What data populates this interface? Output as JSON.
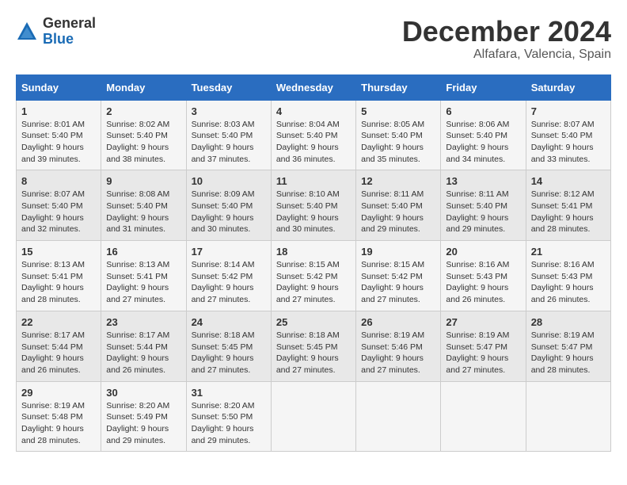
{
  "header": {
    "logo_general": "General",
    "logo_blue": "Blue",
    "month": "December 2024",
    "location": "Alfafara, Valencia, Spain"
  },
  "days_of_week": [
    "Sunday",
    "Monday",
    "Tuesday",
    "Wednesday",
    "Thursday",
    "Friday",
    "Saturday"
  ],
  "weeks": [
    [
      {
        "day": "1",
        "sunrise": "Sunrise: 8:01 AM",
        "sunset": "Sunset: 5:40 PM",
        "daylight": "Daylight: 9 hours and 39 minutes."
      },
      {
        "day": "2",
        "sunrise": "Sunrise: 8:02 AM",
        "sunset": "Sunset: 5:40 PM",
        "daylight": "Daylight: 9 hours and 38 minutes."
      },
      {
        "day": "3",
        "sunrise": "Sunrise: 8:03 AM",
        "sunset": "Sunset: 5:40 PM",
        "daylight": "Daylight: 9 hours and 37 minutes."
      },
      {
        "day": "4",
        "sunrise": "Sunrise: 8:04 AM",
        "sunset": "Sunset: 5:40 PM",
        "daylight": "Daylight: 9 hours and 36 minutes."
      },
      {
        "day": "5",
        "sunrise": "Sunrise: 8:05 AM",
        "sunset": "Sunset: 5:40 PM",
        "daylight": "Daylight: 9 hours and 35 minutes."
      },
      {
        "day": "6",
        "sunrise": "Sunrise: 8:06 AM",
        "sunset": "Sunset: 5:40 PM",
        "daylight": "Daylight: 9 hours and 34 minutes."
      },
      {
        "day": "7",
        "sunrise": "Sunrise: 8:07 AM",
        "sunset": "Sunset: 5:40 PM",
        "daylight": "Daylight: 9 hours and 33 minutes."
      }
    ],
    [
      {
        "day": "8",
        "sunrise": "Sunrise: 8:07 AM",
        "sunset": "Sunset: 5:40 PM",
        "daylight": "Daylight: 9 hours and 32 minutes."
      },
      {
        "day": "9",
        "sunrise": "Sunrise: 8:08 AM",
        "sunset": "Sunset: 5:40 PM",
        "daylight": "Daylight: 9 hours and 31 minutes."
      },
      {
        "day": "10",
        "sunrise": "Sunrise: 8:09 AM",
        "sunset": "Sunset: 5:40 PM",
        "daylight": "Daylight: 9 hours and 30 minutes."
      },
      {
        "day": "11",
        "sunrise": "Sunrise: 8:10 AM",
        "sunset": "Sunset: 5:40 PM",
        "daylight": "Daylight: 9 hours and 30 minutes."
      },
      {
        "day": "12",
        "sunrise": "Sunrise: 8:11 AM",
        "sunset": "Sunset: 5:40 PM",
        "daylight": "Daylight: 9 hours and 29 minutes."
      },
      {
        "day": "13",
        "sunrise": "Sunrise: 8:11 AM",
        "sunset": "Sunset: 5:40 PM",
        "daylight": "Daylight: 9 hours and 29 minutes."
      },
      {
        "day": "14",
        "sunrise": "Sunrise: 8:12 AM",
        "sunset": "Sunset: 5:41 PM",
        "daylight": "Daylight: 9 hours and 28 minutes."
      }
    ],
    [
      {
        "day": "15",
        "sunrise": "Sunrise: 8:13 AM",
        "sunset": "Sunset: 5:41 PM",
        "daylight": "Daylight: 9 hours and 28 minutes."
      },
      {
        "day": "16",
        "sunrise": "Sunrise: 8:13 AM",
        "sunset": "Sunset: 5:41 PM",
        "daylight": "Daylight: 9 hours and 27 minutes."
      },
      {
        "day": "17",
        "sunrise": "Sunrise: 8:14 AM",
        "sunset": "Sunset: 5:42 PM",
        "daylight": "Daylight: 9 hours and 27 minutes."
      },
      {
        "day": "18",
        "sunrise": "Sunrise: 8:15 AM",
        "sunset": "Sunset: 5:42 PM",
        "daylight": "Daylight: 9 hours and 27 minutes."
      },
      {
        "day": "19",
        "sunrise": "Sunrise: 8:15 AM",
        "sunset": "Sunset: 5:42 PM",
        "daylight": "Daylight: 9 hours and 27 minutes."
      },
      {
        "day": "20",
        "sunrise": "Sunrise: 8:16 AM",
        "sunset": "Sunset: 5:43 PM",
        "daylight": "Daylight: 9 hours and 26 minutes."
      },
      {
        "day": "21",
        "sunrise": "Sunrise: 8:16 AM",
        "sunset": "Sunset: 5:43 PM",
        "daylight": "Daylight: 9 hours and 26 minutes."
      }
    ],
    [
      {
        "day": "22",
        "sunrise": "Sunrise: 8:17 AM",
        "sunset": "Sunset: 5:44 PM",
        "daylight": "Daylight: 9 hours and 26 minutes."
      },
      {
        "day": "23",
        "sunrise": "Sunrise: 8:17 AM",
        "sunset": "Sunset: 5:44 PM",
        "daylight": "Daylight: 9 hours and 26 minutes."
      },
      {
        "day": "24",
        "sunrise": "Sunrise: 8:18 AM",
        "sunset": "Sunset: 5:45 PM",
        "daylight": "Daylight: 9 hours and 27 minutes."
      },
      {
        "day": "25",
        "sunrise": "Sunrise: 8:18 AM",
        "sunset": "Sunset: 5:45 PM",
        "daylight": "Daylight: 9 hours and 27 minutes."
      },
      {
        "day": "26",
        "sunrise": "Sunrise: 8:19 AM",
        "sunset": "Sunset: 5:46 PM",
        "daylight": "Daylight: 9 hours and 27 minutes."
      },
      {
        "day": "27",
        "sunrise": "Sunrise: 8:19 AM",
        "sunset": "Sunset: 5:47 PM",
        "daylight": "Daylight: 9 hours and 27 minutes."
      },
      {
        "day": "28",
        "sunrise": "Sunrise: 8:19 AM",
        "sunset": "Sunset: 5:47 PM",
        "daylight": "Daylight: 9 hours and 28 minutes."
      }
    ],
    [
      {
        "day": "29",
        "sunrise": "Sunrise: 8:19 AM",
        "sunset": "Sunset: 5:48 PM",
        "daylight": "Daylight: 9 hours and 28 minutes."
      },
      {
        "day": "30",
        "sunrise": "Sunrise: 8:20 AM",
        "sunset": "Sunset: 5:49 PM",
        "daylight": "Daylight: 9 hours and 29 minutes."
      },
      {
        "day": "31",
        "sunrise": "Sunrise: 8:20 AM",
        "sunset": "Sunset: 5:50 PM",
        "daylight": "Daylight: 9 hours and 29 minutes."
      },
      null,
      null,
      null,
      null
    ]
  ]
}
